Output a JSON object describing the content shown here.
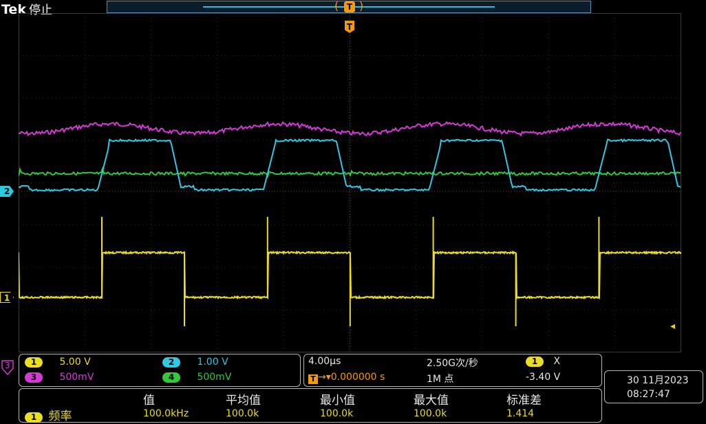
{
  "header": {
    "brand": "Tek",
    "status": "停止"
  },
  "trigger": {
    "top_label": "T",
    "marker_label": "T"
  },
  "markers": {
    "ch2": "2",
    "ch1": "1",
    "ch3": "3"
  },
  "channels": [
    {
      "num": "1",
      "scale": "5.00 V",
      "color": "#ebdc24"
    },
    {
      "num": "2",
      "scale": "1.00 V",
      "color": "#31c8e4"
    },
    {
      "num": "3",
      "scale": "500mV",
      "color": "#d63ad6"
    },
    {
      "num": "4",
      "scale": "500mV",
      "color": "#34c83a"
    }
  ],
  "timebase": {
    "horizontal": "4.00µs",
    "sample_rate": "2.50G次/秒",
    "trigger_source": "1",
    "trigger_coupling": "X",
    "delay": "0.000000 s",
    "record_length": "1M 点",
    "trigger_level": "-3.40 V"
  },
  "datetime": {
    "date": "30 11月2023",
    "time": "08:27:47"
  },
  "measurements": {
    "headers": [
      "值",
      "平均值",
      "最小值",
      "最大值",
      "标准差"
    ],
    "row": {
      "channel": "1",
      "name": "频率",
      "values": [
        "100.0kHz",
        "100.0k",
        "100.0k",
        "100.0k",
        "1.414"
      ]
    }
  },
  "colors": {
    "ch1": "#ebdc24",
    "ch2": "#31c8e4",
    "ch3": "#d63ad6",
    "ch4": "#34c83a",
    "trigger": "#f49a12"
  }
}
